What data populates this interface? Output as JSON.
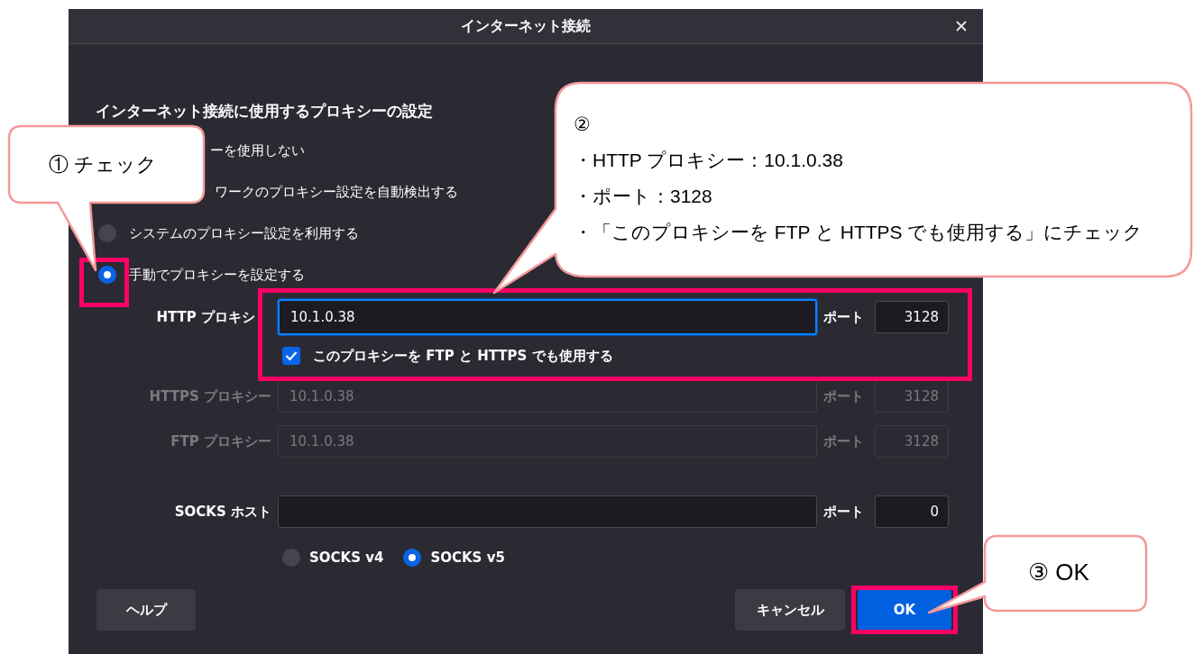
{
  "window": {
    "title": "インターネット接続"
  },
  "heading": "インターネット接続に使用するプロキシーの設定",
  "proxy_modes": [
    {
      "label": "ーを使用しない",
      "kind": "covered"
    },
    {
      "label": "ワークのプロキシー設定を自動検出する",
      "kind": "covered"
    },
    {
      "label": "システムのプロキシー設定を利用する",
      "selected": false,
      "kind": "radio"
    },
    {
      "label": "手動でプロキシーを設定する",
      "selected": true,
      "kind": "radio"
    }
  ],
  "http_proxy": {
    "label": "HTTP プロキシ",
    "value": "10.1.0.38",
    "port_label": "ポート",
    "port": "3128"
  },
  "share_proxy": {
    "label": "このプロキシーを FTP と HTTPS でも使用する",
    "checked": true
  },
  "other_proxies": [
    {
      "label": "HTTPS プロキシー",
      "value": "10.1.0.38",
      "port_label": "ポート",
      "port": "3128",
      "disabled": true
    },
    {
      "label": "FTP プロキシー",
      "value": "10.1.0.38",
      "port_label": "ポート",
      "port": "3128",
      "disabled": true
    }
  ],
  "socks": {
    "label": "SOCKS ホスト",
    "port_label": "ポート",
    "port": "0"
  },
  "socks_versions": [
    {
      "label": "SOCKS v4",
      "selected": false
    },
    {
      "label": "SOCKS v5",
      "selected": true
    }
  ],
  "buttons": [
    {
      "label": "ヘルプ",
      "kind": "secondary"
    },
    {
      "label": "キャンセル",
      "kind": "secondary"
    },
    {
      "label": "OK",
      "kind": "primary"
    }
  ],
  "callouts": [
    {
      "lines": [
        "①  チェック"
      ]
    },
    {
      "lines": [
        "②",
        "・HTTP プロキシー：10.1.0.38",
        "・ポート：3128",
        "・「このプロキシーを FTP と HTTPS でも使用する」にチェック"
      ]
    },
    {
      "lines": [
        "③  OK"
      ]
    }
  ]
}
